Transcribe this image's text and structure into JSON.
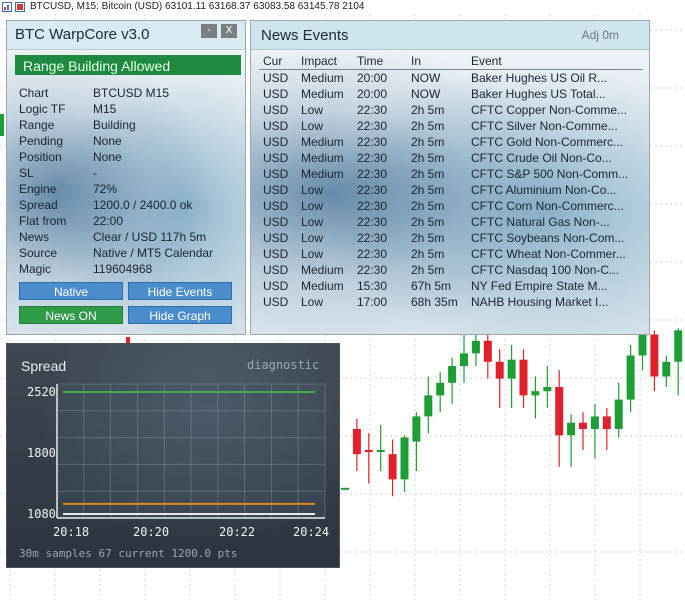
{
  "topbar": {
    "text": "BTCUSD, M15:  Bitcoin (USD)  63101.11 63168.37 63083.58 63145.78  2104"
  },
  "warpcore": {
    "title": "BTC WarpCore v3.0",
    "minimize_label": "-",
    "close_label": "X",
    "status": "Range Building Allowed",
    "status_color": "#1f8a3f",
    "rows": [
      {
        "key": "Chart",
        "value": "BTCUSD M15"
      },
      {
        "key": "Logic TF",
        "value": "M15"
      },
      {
        "key": "Range",
        "value": "Building"
      },
      {
        "key": "Pending",
        "value": "None"
      },
      {
        "key": "Position",
        "value": "None"
      },
      {
        "key": "SL",
        "value": "-"
      },
      {
        "key": "Engine",
        "value": "72%"
      },
      {
        "key": "Spread",
        "value": "1200.0 / 2400.0 ok"
      },
      {
        "key": "Flat from",
        "value": "22:00"
      },
      {
        "key": "News",
        "value": "Clear / USD 117h 5m"
      },
      {
        "key": "Source",
        "value": "Native / MT5 Calendar"
      },
      {
        "key": "Magic",
        "value": "119604968"
      }
    ],
    "buttons": {
      "native": "Native",
      "hide_events": "Hide Events",
      "news_on": "News ON",
      "hide_graph": "Hide Graph"
    }
  },
  "news": {
    "title": "News Events",
    "adj": "Adj 0m",
    "headers": [
      "Cur",
      "Impact",
      "Time",
      "In",
      "Event"
    ],
    "rows": [
      [
        "USD",
        "Medium",
        "20:00",
        "NOW",
        "Baker Hughes US Oil R..."
      ],
      [
        "USD",
        "Medium",
        "20:00",
        "NOW",
        "Baker Hughes US Total..."
      ],
      [
        "USD",
        "Low",
        "22:30",
        "2h 5m",
        "CFTC Copper Non-Comme..."
      ],
      [
        "USD",
        "Low",
        "22:30",
        "2h 5m",
        "CFTC Silver Non-Comme..."
      ],
      [
        "USD",
        "Medium",
        "22:30",
        "2h 5m",
        "CFTC Gold Non-Commerc..."
      ],
      [
        "USD",
        "Medium",
        "22:30",
        "2h 5m",
        "CFTC Crude Oil Non-Co..."
      ],
      [
        "USD",
        "Medium",
        "22:30",
        "2h 5m",
        "CFTC S&P 500 Non-Comm..."
      ],
      [
        "USD",
        "Low",
        "22:30",
        "2h 5m",
        "CFTC Aluminium Non-Co..."
      ],
      [
        "USD",
        "Low",
        "22:30",
        "2h 5m",
        "CFTC Corn Non-Commerc..."
      ],
      [
        "USD",
        "Low",
        "22:30",
        "2h 5m",
        "CFTC Natural Gas Non-..."
      ],
      [
        "USD",
        "Low",
        "22:30",
        "2h 5m",
        "CFTC Soybeans Non-Com..."
      ],
      [
        "USD",
        "Low",
        "22:30",
        "2h 5m",
        "CFTC Wheat Non-Commer..."
      ],
      [
        "USD",
        "Medium",
        "22:30",
        "2h 5m",
        "CFTC Nasdaq 100 Non-C..."
      ],
      [
        "USD",
        "Medium",
        "15:30",
        "67h 5m",
        "NY Fed Empire State M..."
      ],
      [
        "USD",
        "Low",
        "17:00",
        "68h 35m",
        "NAHB Housing Market I..."
      ]
    ]
  },
  "spread_graph": {
    "title": "Spread",
    "mode": "diagnostic",
    "footer": "30m samples 67   current 1200.0 pts",
    "chart_data": {
      "type": "line",
      "title": "Spread",
      "y_ticks": [
        "2520",
        "1800",
        "1080"
      ],
      "ylim": [
        1080,
        2520
      ],
      "x_ticks": [
        "20:18",
        "20:20",
        "20:22",
        "20:24"
      ],
      "series": [
        {
          "name": "",
          "color": "#3fae4a",
          "values": [
            2520,
            2520
          ]
        },
        {
          "name": "",
          "color": "#e08a1e",
          "values": [
            1200,
            1200
          ]
        },
        {
          "name": "",
          "color": "#e8e8e8",
          "values": [
            1080,
            1080
          ]
        }
      ]
    }
  },
  "chart_data": {
    "type": "candlestick",
    "up_color": "#1e9e36",
    "down_color": "#e0202a",
    "ylim": [
      0,
      100
    ],
    "candles": [
      {
        "o": 22,
        "h": 22,
        "l": 22,
        "c": 22
      },
      {
        "o": 50,
        "h": 55,
        "l": 30,
        "c": 38
      },
      {
        "o": 40,
        "h": 48,
        "l": 24,
        "c": 39
      },
      {
        "o": 40,
        "h": 52,
        "l": 30,
        "c": 40
      },
      {
        "o": 38,
        "h": 45,
        "l": 18,
        "c": 26
      },
      {
        "o": 26,
        "h": 47,
        "l": 20,
        "c": 46
      },
      {
        "o": 44,
        "h": 58,
        "l": 30,
        "c": 56
      },
      {
        "o": 56,
        "h": 75,
        "l": 48,
        "c": 66
      },
      {
        "o": 66,
        "h": 77,
        "l": 58,
        "c": 72
      },
      {
        "o": 72,
        "h": 84,
        "l": 62,
        "c": 80
      },
      {
        "o": 80,
        "h": 95,
        "l": 72,
        "c": 86
      },
      {
        "o": 86,
        "h": 101,
        "l": 80,
        "c": 92
      },
      {
        "o": 92,
        "h": 95,
        "l": 74,
        "c": 82
      },
      {
        "o": 82,
        "h": 88,
        "l": 60,
        "c": 74
      },
      {
        "o": 74,
        "h": 90,
        "l": 60,
        "c": 83
      },
      {
        "o": 83,
        "h": 88,
        "l": 60,
        "c": 66
      },
      {
        "o": 66,
        "h": 75,
        "l": 55,
        "c": 68
      },
      {
        "o": 68,
        "h": 80,
        "l": 60,
        "c": 70
      },
      {
        "o": 70,
        "h": 78,
        "l": 32,
        "c": 47
      },
      {
        "o": 47,
        "h": 57,
        "l": 32,
        "c": 53
      },
      {
        "o": 53,
        "h": 58,
        "l": 40,
        "c": 50
      },
      {
        "o": 50,
        "h": 62,
        "l": 36,
        "c": 56
      },
      {
        "o": 56,
        "h": 60,
        "l": 40,
        "c": 50
      },
      {
        "o": 50,
        "h": 72,
        "l": 46,
        "c": 64
      },
      {
        "o": 64,
        "h": 90,
        "l": 58,
        "c": 85
      },
      {
        "o": 85,
        "h": 115,
        "l": 78,
        "c": 95
      },
      {
        "o": 95,
        "h": 97,
        "l": 68,
        "c": 75
      },
      {
        "o": 75,
        "h": 85,
        "l": 70,
        "c": 82
      },
      {
        "o": 82,
        "h": 98,
        "l": 66,
        "c": 97
      }
    ]
  }
}
